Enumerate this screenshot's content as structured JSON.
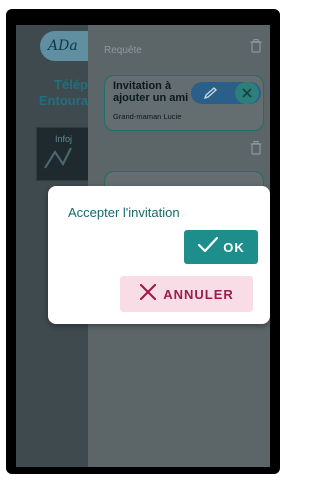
{
  "background_app": {
    "logo_text": "ADa",
    "left_texts": [
      "Télép",
      "Entoura"
    ],
    "thumb_label": "Infoj",
    "section_label": "Requête",
    "card": {
      "title": "Invitation à ajouter un ami",
      "subtitle": "Grand-maman Lucie"
    }
  },
  "dialog": {
    "title": "Accepter l'invitation",
    "ok_label": "OK",
    "cancel_label": "ANNULER"
  },
  "colors": {
    "teal": "#1d8e8c",
    "cancel_bg": "#f8dde6",
    "cancel_text": "#9c1c4c"
  }
}
